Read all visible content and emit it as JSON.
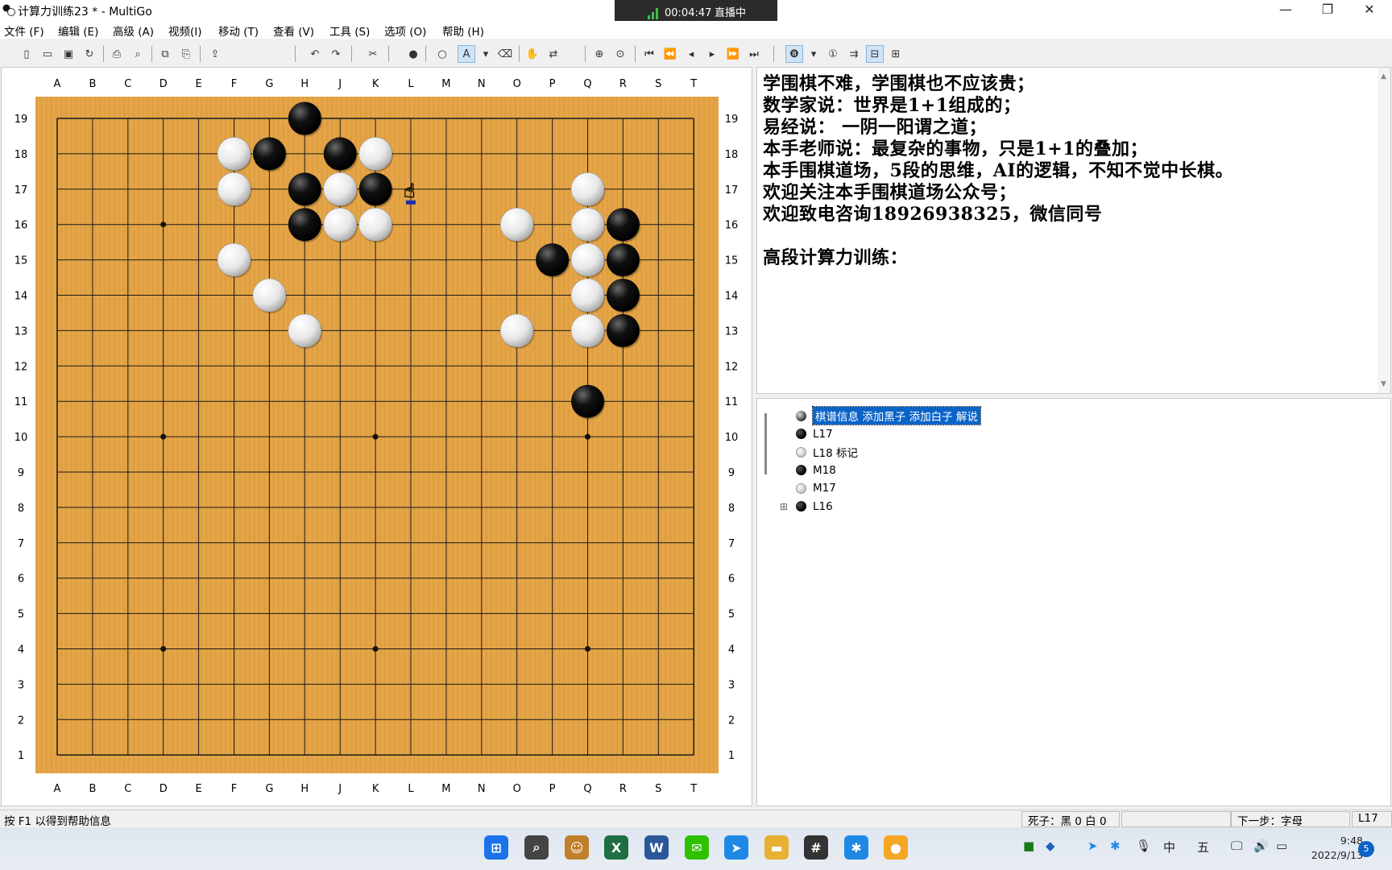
{
  "window": {
    "title": "计算力训练23  * - MultiGo",
    "controls": {
      "minimize": "—",
      "restore": "❐",
      "close": "✕"
    }
  },
  "live": {
    "time": "00:04:47",
    "label": "直播中"
  },
  "menu": [
    "文件 (F)",
    "编辑 (E)",
    "高级 (A)",
    "视频(I)",
    "移动 (T)",
    "查看 (V)",
    "工具 (S)",
    "选项 (O)",
    "帮助 (H)"
  ],
  "board": {
    "size": 19,
    "columns": [
      "A",
      "B",
      "C",
      "D",
      "E",
      "F",
      "G",
      "H",
      "J",
      "K",
      "L",
      "M",
      "N",
      "O",
      "P",
      "Q",
      "R",
      "S",
      "T"
    ],
    "rows": [
      "19",
      "18",
      "17",
      "16",
      "15",
      "14",
      "13",
      "12",
      "11",
      "10",
      "9",
      "8",
      "7",
      "6",
      "5",
      "4",
      "3",
      "2",
      "1"
    ],
    "hoshi": [
      "D16",
      "K16",
      "Q16",
      "D10",
      "K10",
      "Q10",
      "D4",
      "K4",
      "Q4"
    ],
    "black_stones": [
      "H19",
      "G18",
      "J18",
      "H17",
      "K17",
      "H16",
      "R16",
      "P15",
      "R15",
      "R14",
      "R13",
      "Q11"
    ],
    "white_stones": [
      "F18",
      "K18",
      "F17",
      "J17",
      "Q17",
      "J16",
      "K16",
      "O16",
      "Q16",
      "F15",
      "Q15",
      "G14",
      "Q14",
      "H13",
      "O13",
      "Q13"
    ],
    "colors": {
      "wood": "#e3a344",
      "line": "#1a1a1a",
      "black": "#111111",
      "white": "#f2f2f2"
    }
  },
  "comment": {
    "lines": [
      "学围棋不难，学围棋也不应该贵；",
      "数学家说：世界是1+1组成的；",
      "易经说： 一阴一阳谓之道；",
      "本手老师说：最复杂的事物，只是1+1的叠加；",
      "本手围棋道场，5段的思维，AI的逻辑，不知不觉中长棋。",
      "欢迎关注本手围棋道场公众号；",
      "欢迎致电咨询18926938325，微信同号",
      "",
      "高段计算力训练："
    ]
  },
  "tree": {
    "nodes": [
      {
        "label": "棋谱信息 添加黑子 添加白子 解说",
        "stone": "info",
        "selected": true
      },
      {
        "label": "L17",
        "stone": "black"
      },
      {
        "label": "L18 标记",
        "stone": "white"
      },
      {
        "label": "M18",
        "stone": "black"
      },
      {
        "label": "M17",
        "stone": "white"
      },
      {
        "label": "L16",
        "stone": "black",
        "expander": "⊞"
      }
    ]
  },
  "status": {
    "help": "按 F1 以得到帮助信息",
    "captures": "死子：黑 0 白 0",
    "next_step": "下一步：字母",
    "coord": "L17"
  },
  "taskbar": {
    "apps": [
      {
        "name": "start-icon",
        "glyph": "⊞",
        "color": "#1a73e8"
      },
      {
        "name": "search-icon",
        "glyph": "⌕",
        "color": "#444444"
      },
      {
        "name": "game-app-icon",
        "glyph": "☺",
        "color": "#c0802a"
      },
      {
        "name": "excel-icon",
        "glyph": "X",
        "color": "#1d6f42"
      },
      {
        "name": "word-icon",
        "glyph": "W",
        "color": "#2b579a"
      },
      {
        "name": "wechat-icon",
        "glyph": "✉",
        "color": "#2dc100"
      },
      {
        "name": "feishu-icon",
        "glyph": "➤",
        "color": "#1e88e5"
      },
      {
        "name": "folder-icon",
        "glyph": "▬",
        "color": "#e8b030"
      },
      {
        "name": "multigo-icon",
        "glyph": "#",
        "color": "#333333"
      },
      {
        "name": "settings-app-icon",
        "glyph": "✱",
        "color": "#1e88e5"
      },
      {
        "name": "media-app-icon",
        "glyph": "●",
        "color": "#f5a623"
      }
    ],
    "tray": {
      "ime": "中",
      "ime2": "五",
      "time": "9:48",
      "date": "2022/9/13",
      "notifications": "5"
    }
  }
}
